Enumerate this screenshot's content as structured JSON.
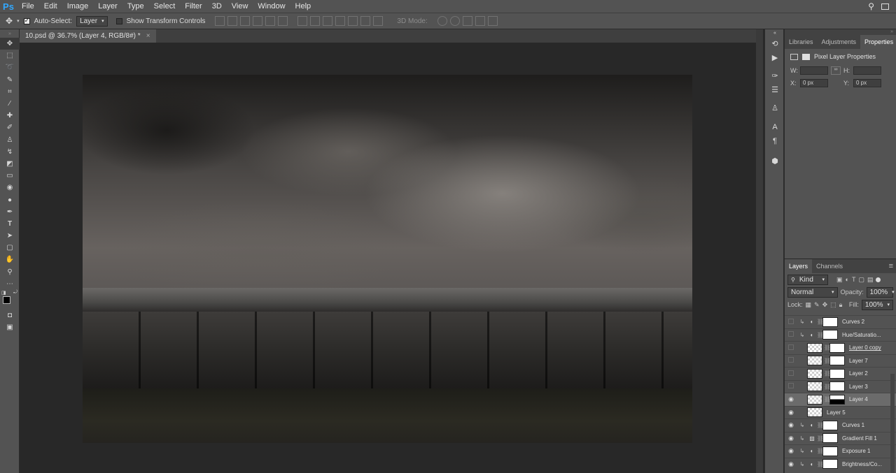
{
  "app": {
    "logo": "Ps"
  },
  "menu": [
    "File",
    "Edit",
    "Image",
    "Layer",
    "Type",
    "Select",
    "Filter",
    "3D",
    "View",
    "Window",
    "Help"
  ],
  "options": {
    "auto_select_label": "Auto-Select:",
    "auto_select_value": "Layer",
    "transform_label": "Show Transform Controls",
    "mode_3d_label": "3D Mode:"
  },
  "document": {
    "tab_title": "10.psd @ 36.7% (Layer 4, RGB/8#) *",
    "close": "×"
  },
  "properties": {
    "tabs": [
      "Libraries",
      "Adjustments",
      "Properties"
    ],
    "title": "Pixel Layer Properties",
    "w_label": "W:",
    "h_label": "H:",
    "x_label": "X:",
    "y_label": "Y:",
    "x_value": "0 px",
    "y_value": "0 px"
  },
  "layers_panel": {
    "tabs": [
      "Layers",
      "Channels"
    ],
    "filter_label": "Kind",
    "blend_mode": "Normal",
    "opacity_label": "Opacity:",
    "opacity_value": "100%",
    "lock_label": "Lock:",
    "fill_label": "Fill:",
    "fill_value": "100%",
    "layers": [
      {
        "name": "Curves 2",
        "visible": false,
        "clipped": true,
        "type": "adjustment",
        "thumb": "white"
      },
      {
        "name": "Hue/Saturatio...",
        "visible": false,
        "clipped": true,
        "type": "adjustment",
        "thumb": "white"
      },
      {
        "name": "Layer 0 copy",
        "visible": false,
        "clipped": false,
        "type": "pixel",
        "thumb": "white"
      },
      {
        "name": "Layer 7",
        "visible": false,
        "clipped": false,
        "type": "pixel",
        "thumb": "white"
      },
      {
        "name": "Layer 2",
        "visible": false,
        "clipped": false,
        "type": "pixel",
        "thumb": "white"
      },
      {
        "name": "Layer 3",
        "visible": false,
        "clipped": false,
        "type": "pixel",
        "thumb": "white"
      },
      {
        "name": "Layer 4",
        "visible": true,
        "clipped": false,
        "type": "pixel",
        "thumb": "black-half",
        "selected": true
      },
      {
        "name": "Layer 5",
        "visible": true,
        "clipped": false,
        "type": "pixel",
        "thumb": "none"
      },
      {
        "name": "Curves 1",
        "visible": true,
        "clipped": true,
        "type": "adjustment",
        "thumb": "white"
      },
      {
        "name": "Gradient Fill 1",
        "visible": true,
        "clipped": true,
        "type": "fill",
        "thumb": "white"
      },
      {
        "name": "Exposure 1",
        "visible": true,
        "clipped": true,
        "type": "adjustment",
        "thumb": "white"
      },
      {
        "name": "Brightness/Co...",
        "visible": true,
        "clipped": true,
        "type": "adjustment",
        "thumb": "white"
      }
    ]
  }
}
